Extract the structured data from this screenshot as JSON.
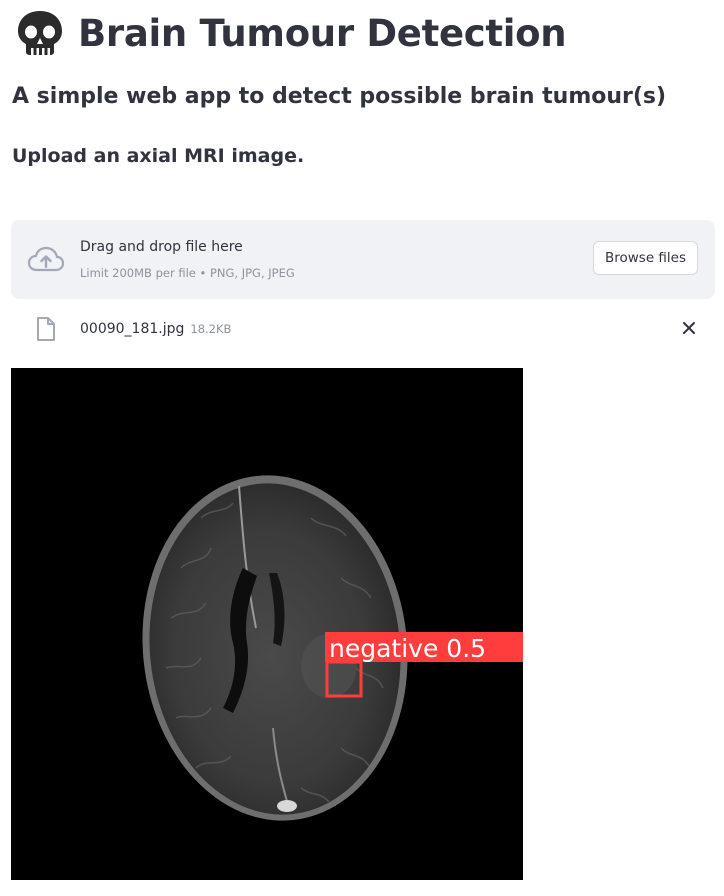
{
  "app": {
    "title": "Brain Tumour Detection",
    "title_icon": "skull-icon",
    "subtitle": "A simple web app to detect possible brain tumour(s)",
    "instruction": "Upload an axial MRI image."
  },
  "uploader": {
    "icon": "cloud-upload-icon",
    "drag_text": "Drag and drop file here",
    "limit_text": "Limit 200MB per file • PNG, JPG, JPEG",
    "browse_label": "Browse files"
  },
  "uploaded_file": {
    "icon": "file-icon",
    "name": "00090_181.jpg",
    "size": "18.2KB",
    "remove_icon": "close-icon"
  },
  "result": {
    "detection_label": "negative 0.5",
    "box_color": "#ff3d3d"
  },
  "colors": {
    "text": "#31333f",
    "muted": "#8e929b",
    "dropzone_bg": "#f0f2f6",
    "icon": "#a3a8b8"
  }
}
